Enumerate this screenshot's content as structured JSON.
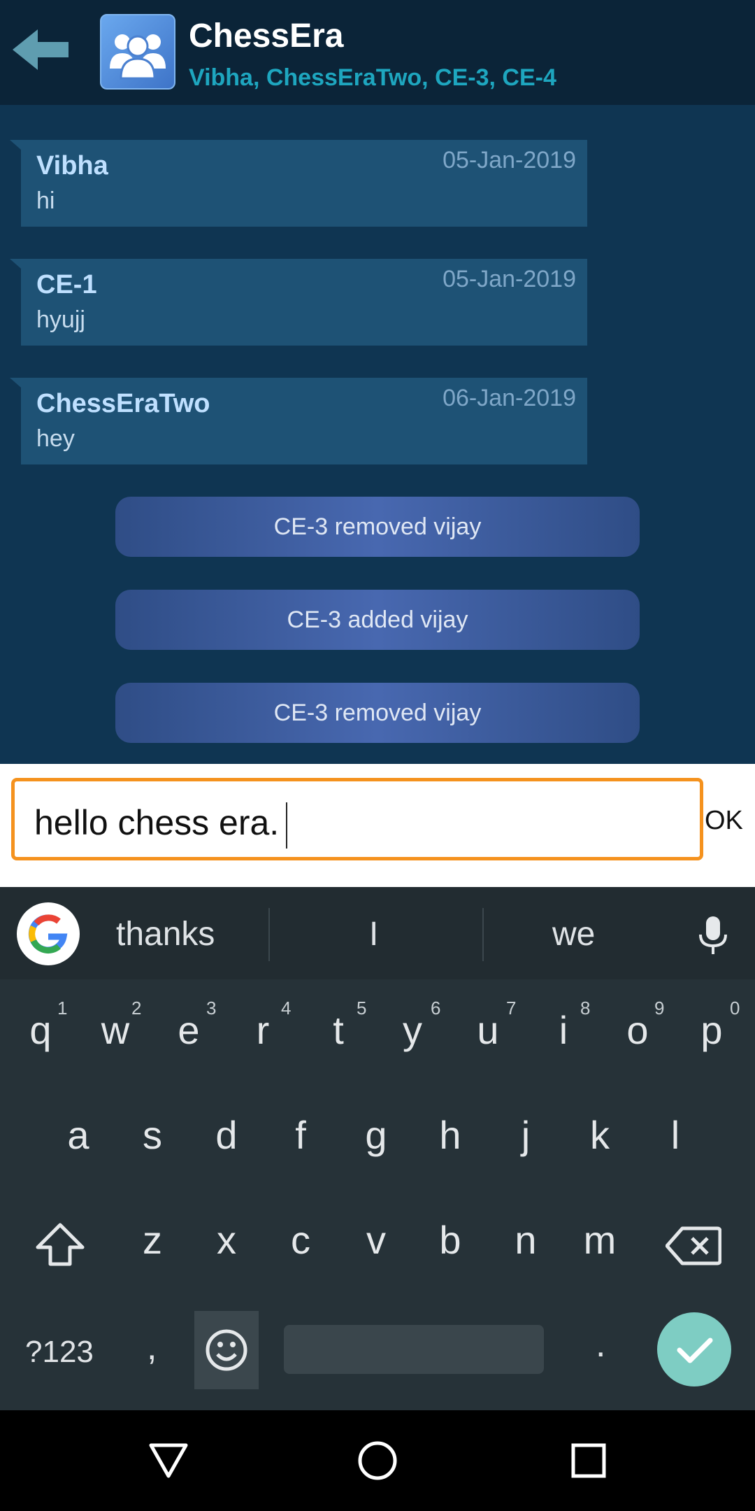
{
  "header": {
    "title": "ChessEra",
    "members": "Vibha, ChessEraTwo, CE-3, CE-4"
  },
  "messages": [
    {
      "sender": "Vibha",
      "text": "hi",
      "date": "05-Jan-2019"
    },
    {
      "sender": "CE-1",
      "text": "hyujj",
      "date": "05-Jan-2019"
    },
    {
      "sender": "ChessEraTwo",
      "text": "hey",
      "date": "06-Jan-2019"
    }
  ],
  "system_notes": [
    "CE-3 removed vijay",
    "CE-3 added vijay",
    "CE-3 removed vijay"
  ],
  "composer": {
    "value": "hello chess era.",
    "ok_label": "OK"
  },
  "keyboard": {
    "suggestions": [
      "thanks",
      "I",
      "we"
    ],
    "row1": [
      "q",
      "w",
      "e",
      "r",
      "t",
      "y",
      "u",
      "i",
      "o",
      "p"
    ],
    "row1_numbers": [
      "1",
      "2",
      "3",
      "4",
      "5",
      "6",
      "7",
      "8",
      "9",
      "0"
    ],
    "row2": [
      "a",
      "s",
      "d",
      "f",
      "g",
      "h",
      "j",
      "k",
      "l"
    ],
    "row3": [
      "z",
      "x",
      "c",
      "v",
      "b",
      "n",
      "m"
    ],
    "symbols_label": "?123",
    "comma": ",",
    "period": "."
  },
  "colors": {
    "accent_input_border": "#f5921e",
    "enter_key": "#7ecdc3",
    "subtitle": "#1ea6bf"
  }
}
